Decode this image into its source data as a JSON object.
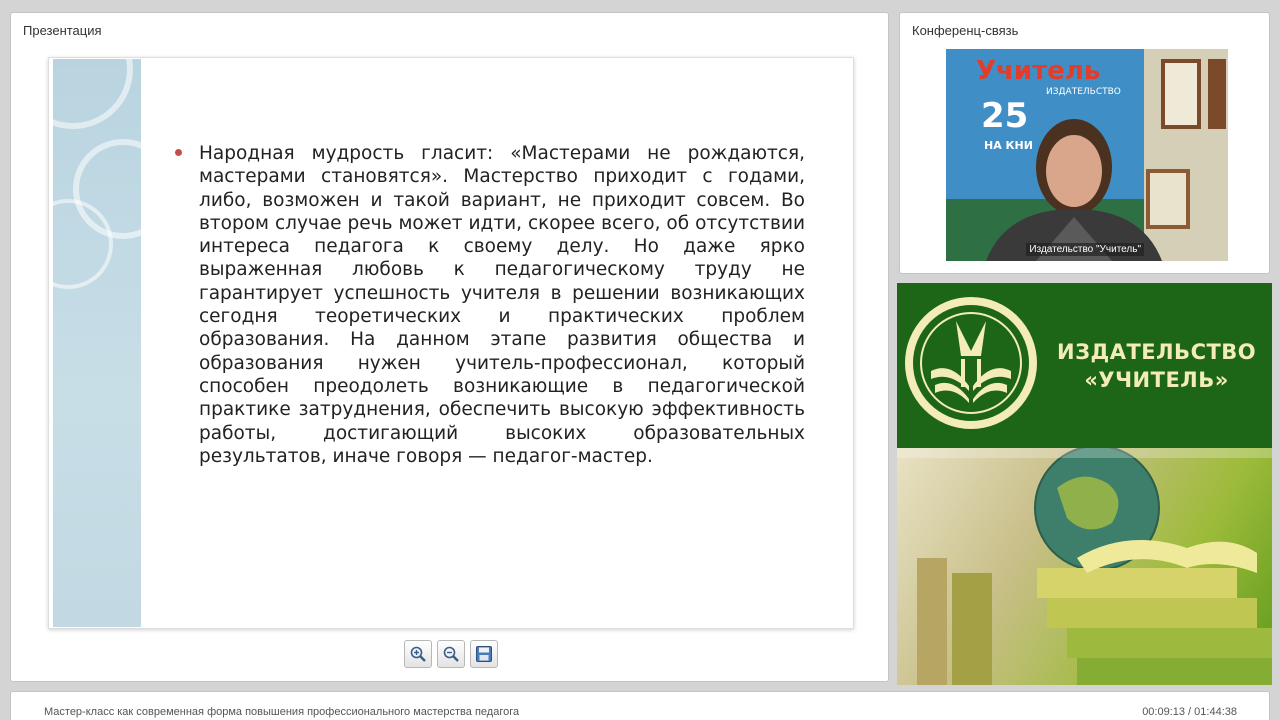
{
  "presentation": {
    "title": "Презентация",
    "slide_text": "Народная мудрость гласит: «Мастерами не рождаются, мастерами становятся». Мастерство приходит с годами, либо, возможен и такой вариант, не приходит совсем. Во втором случае речь может идти, скорее всего, об отсутствии интереса педагога к своему делу. Но даже ярко выраженная любовь к педагогическому труду не гарантирует успешность учителя в решении возникающих сегодня теоретических и практических проблем образования. На данном этапе развития общества и образования нужен учитель-профессионал, который способен преодолеть возникающие в педагогической практике затруднения, обеспечить высокую эффективность работы, достигающий высоких образовательных результатов, иначе говоря — педагог-мастер.",
    "toolbar": {
      "zoom_in_icon": "zoom-in-icon",
      "zoom_out_icon": "zoom-out-icon",
      "save_icon": "save-icon"
    }
  },
  "conference": {
    "title": "Конференц-связь",
    "video_label": "Издательство \"Учитель\"",
    "poster_text": "Учитель",
    "poster_sub": "ИЗДАТЕЛЬСТВО",
    "poster_number": "25",
    "poster_tag": "НА КНИ"
  },
  "brand": {
    "line1": "ИЗДАТЕЛЬСТВО",
    "line2": "«УЧИТЕЛЬ»"
  },
  "footer": {
    "course_title": "Мастер-класс как современная форма повышения профессионального мастерства педагога",
    "timer": "00:09:13 / 01:44:38"
  },
  "colors": {
    "brand_green": "#1d6517",
    "brand_gold": "#f3ecb8",
    "bullet_red": "#c0504d",
    "slide_side": "#b9d4e0"
  }
}
